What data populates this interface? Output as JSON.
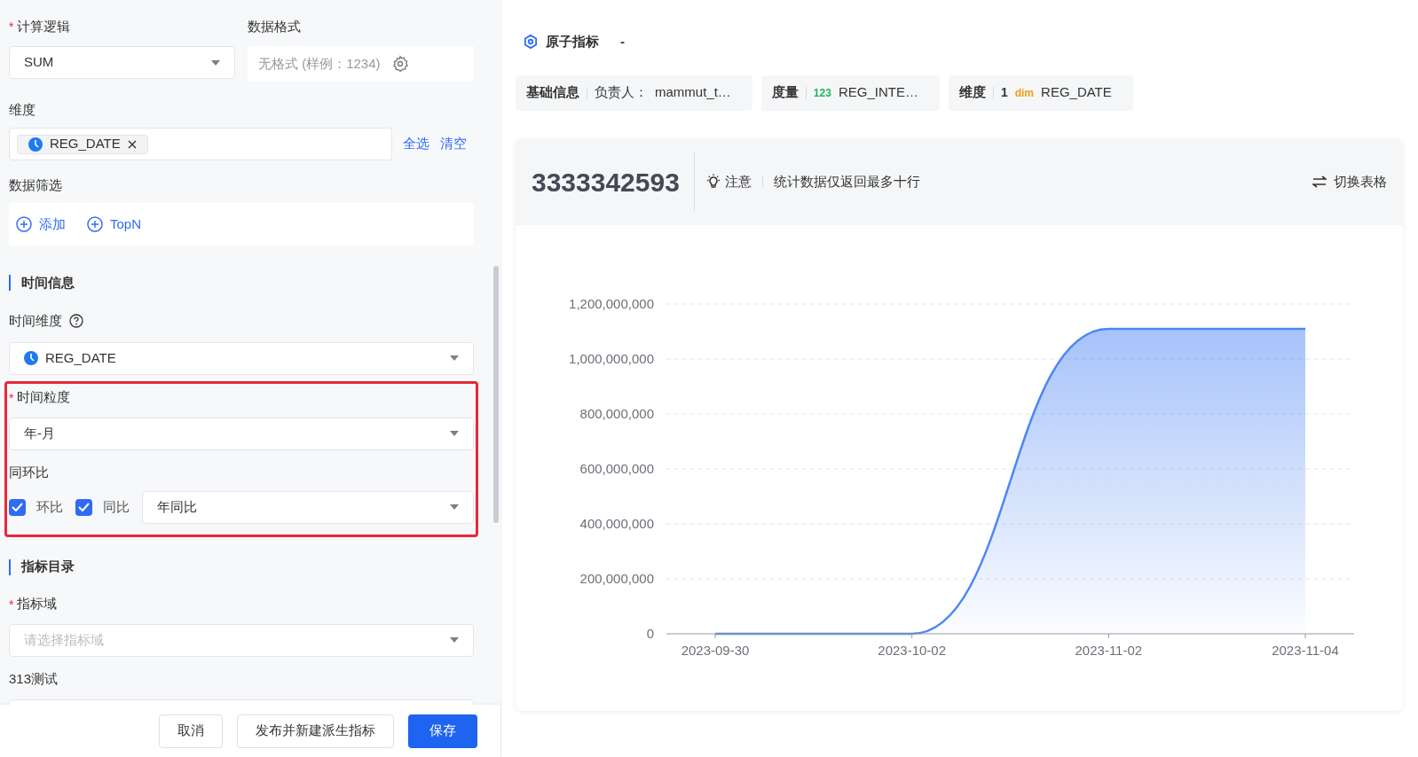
{
  "form": {
    "calc_logic": {
      "label": "计算逻辑",
      "required_mark": "*",
      "value": "SUM"
    },
    "data_format": {
      "label": "数据格式",
      "placeholder": "无格式 (样例：1234)"
    },
    "dimension": {
      "label": "维度",
      "tags": [
        "REG_DATE"
      ],
      "links": [
        "全选",
        "清空"
      ]
    },
    "data_filter": {
      "label": "数据筛选",
      "actions": [
        "添加",
        "TopN"
      ]
    },
    "time_section": {
      "title": "时间信息"
    },
    "time_dimension": {
      "label": "时间维度",
      "value": "REG_DATE"
    },
    "time_granularity": {
      "label": "时间粒度",
      "required_mark": "*",
      "value": "年-月"
    },
    "comparison": {
      "label": "同环比",
      "options": [
        {
          "label": "环比",
          "checked": true
        },
        {
          "label": "同比",
          "checked": true
        }
      ],
      "select_value": "年同比"
    },
    "catalog_section": {
      "title": "指标目录"
    },
    "metric_domain": {
      "label": "指标域",
      "required_mark": "*",
      "placeholder": "请选择指标域"
    },
    "test_field": {
      "label": "313测试"
    },
    "buttons": [
      {
        "label": "取消",
        "kind": "default"
      },
      {
        "label": "发布并新建派生指标",
        "kind": "default"
      },
      {
        "label": "保存",
        "kind": "primary"
      }
    ]
  },
  "preview": {
    "title": "原子指标",
    "title_suffix": "-",
    "chips": [
      {
        "label": "基础信息",
        "prefix": "负责人：",
        "value": "mammut_t…"
      },
      {
        "label": "度量",
        "badge": "123",
        "color": "#22b35e",
        "value": "REG_INTE…"
      },
      {
        "label": "维度",
        "count": "1",
        "badge": "dim",
        "color": "#f39c12",
        "value": "REG_DATE"
      }
    ],
    "total": "3333342593",
    "notice_label": "注意",
    "notice_text": "统计数据仅返回最多十行",
    "switch_label": "切换表格",
    "chart_data": {
      "type": "area",
      "categories": [
        "2023-09-30",
        "2023-10-02",
        "2023-11-02",
        "2023-11-04"
      ],
      "series": [
        {
          "color": "#4e86f5",
          "values": [
            0,
            0,
            1110000000,
            1110000000
          ]
        }
      ],
      "grid": true,
      "ylim": [
        0,
        1200000000
      ],
      "yticks": [
        {
          "value": 0,
          "label": "0"
        },
        {
          "value": 200000000,
          "label": "200,000,000"
        },
        {
          "value": 400000000,
          "label": "400,000,000"
        },
        {
          "value": 600000000,
          "label": "600,000,000"
        },
        {
          "value": 800000000,
          "label": "800,000,000"
        },
        {
          "value": 1000000000,
          "label": "1,000,000,000"
        },
        {
          "value": 1200000000,
          "label": "1,200,000,000"
        }
      ]
    }
  }
}
